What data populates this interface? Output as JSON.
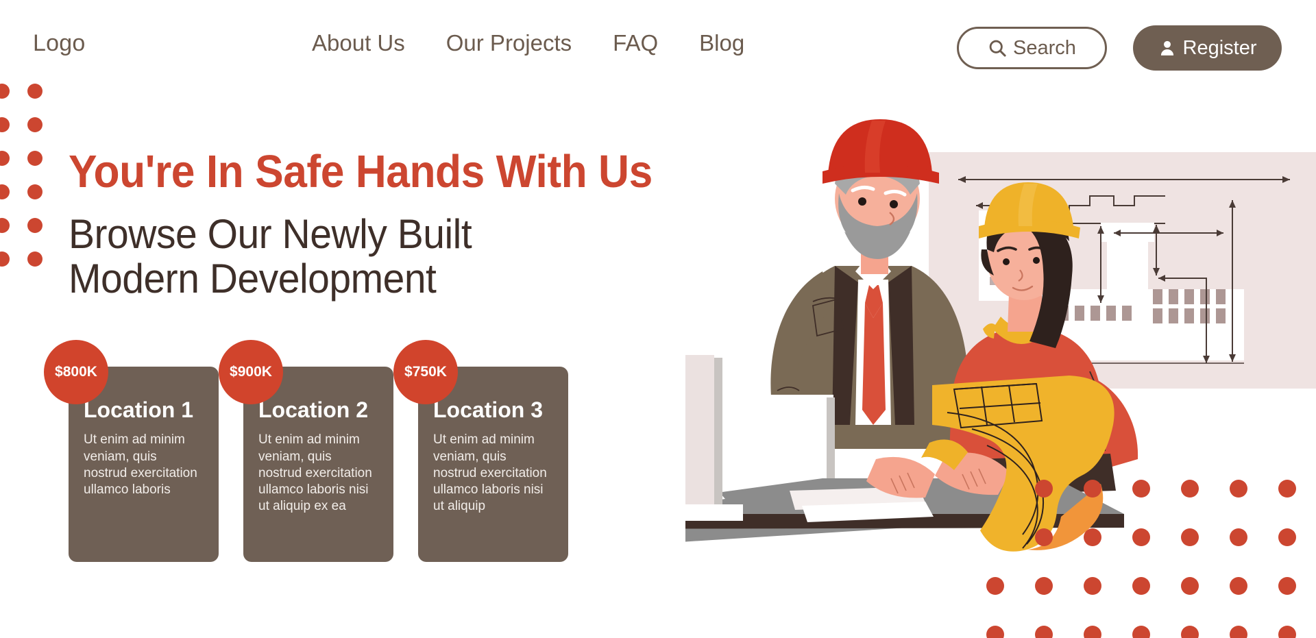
{
  "header": {
    "logo": "Logo",
    "nav": [
      {
        "label": "About Us"
      },
      {
        "label": "Our Projects"
      },
      {
        "label": "FAQ"
      },
      {
        "label": "Blog"
      }
    ],
    "search_label": "Search",
    "register_label": "Register"
  },
  "hero": {
    "headline": "You're In Safe Hands With Us",
    "subheadline_line1": "Browse Our Newly Built",
    "subheadline_line2": "Modern Development"
  },
  "cards": [
    {
      "badge": "$800K",
      "title": "Location 1",
      "text": "Ut enim ad minim veniam, quis nostrud exercitation ullamco laboris"
    },
    {
      "badge": "$900K",
      "title": "Location 2",
      "text": "Ut enim ad minim veniam, quis nostrud exercitation ullamco laboris nisi ut aliquip ex ea"
    },
    {
      "badge": "$750K",
      "title": "Location 3",
      "text": "Ut enim ad minim veniam, quis nostrud exercitation ullamco laboris nisi ut aliquip"
    }
  ],
  "colors": {
    "accent_red": "#CC4630",
    "badge_red": "#D1442C",
    "card_brown": "#6F6055",
    "button_brown": "#6F5F52",
    "heading_dark": "#3E2F29",
    "nav_text": "#6B5B4E",
    "blueprint_bg": "#EFE3E2",
    "hardhat_yellow": "#EFB229",
    "shirt_red": "#D9503A",
    "suit_brown": "#7A6A55",
    "desk_gray": "#8C8C8C",
    "blueprint_roll": "#F0B32B"
  },
  "illustration": {
    "name": "architects-reviewing-building-model",
    "elements": [
      "male-architect-red-hardhat",
      "female-architect-yellow-hardhat",
      "blueprint-wall-panel",
      "desk-with-building-model",
      "rolled-blueprint-sheet"
    ]
  },
  "decor": {
    "left_dot_columns": 2,
    "left_dot_rows": 6,
    "right_dot_columns": 6,
    "right_dot_rows": 4
  }
}
